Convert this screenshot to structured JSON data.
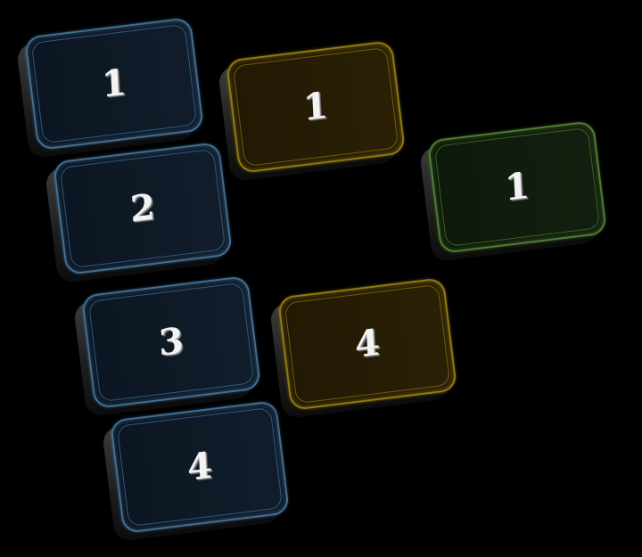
{
  "board": {
    "tiles": [
      {
        "value": "1",
        "color": "blue"
      },
      {
        "value": "2",
        "color": "blue"
      },
      {
        "value": "3",
        "color": "blue"
      },
      {
        "value": "4",
        "color": "blue"
      },
      {
        "value": "1",
        "color": "gold"
      },
      {
        "value": "4",
        "color": "gold"
      },
      {
        "value": "1",
        "color": "green"
      }
    ]
  },
  "colors": {
    "background": "#000000",
    "blue_border": "#3f6f95",
    "gold_border": "#8f7a0e",
    "green_border": "#4f7d2f",
    "number": "#f3f3f3"
  }
}
